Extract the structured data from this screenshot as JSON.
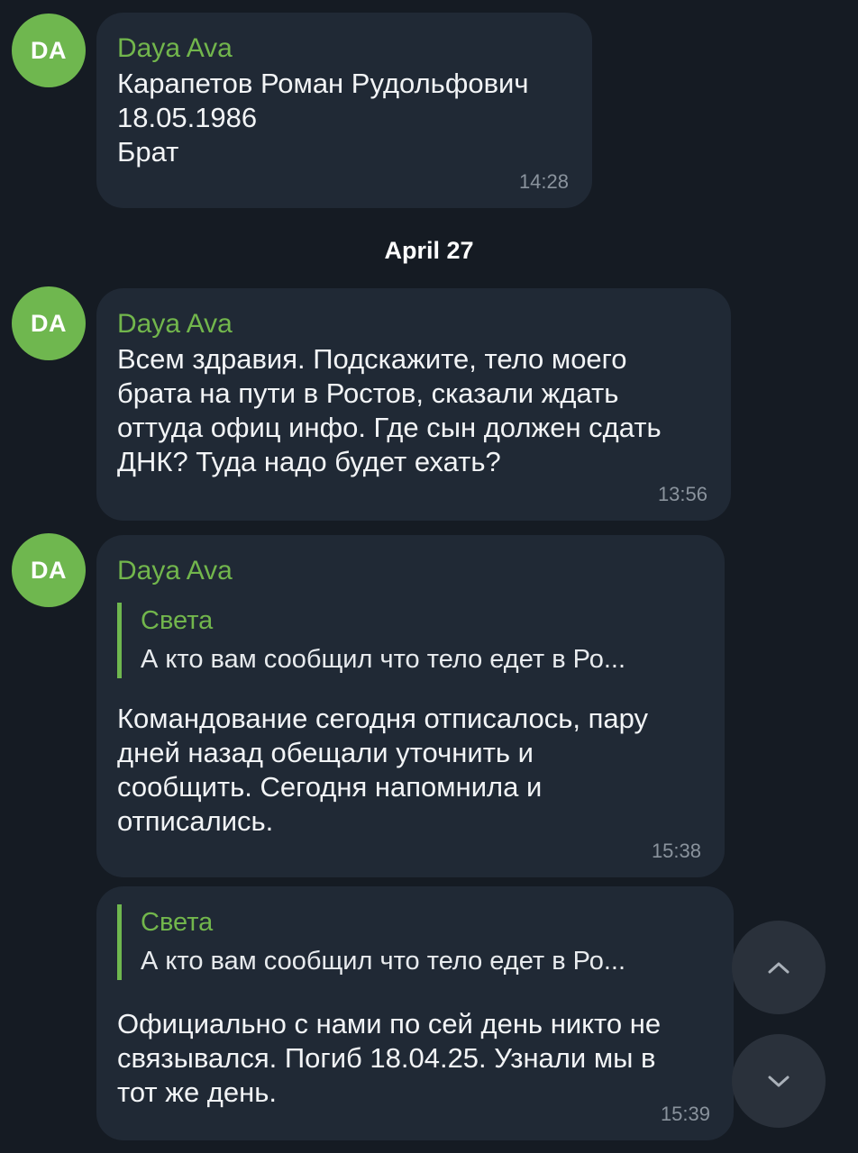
{
  "messages": [
    {
      "avatar": "DA",
      "sender": "Daya Ava",
      "text": "Карапетов Роман Рудольфович\n18.05.1986\nБрат",
      "time": "14:28"
    },
    {
      "avatar": "DA",
      "sender": "Daya Ava",
      "text": "Всем здравия. Подскажите, тело моего\nбрата на пути в Ростов, сказали ждать\nоттуда офиц инфо. Где сын должен сдать\nДНК? Туда надо будет ехать?",
      "time": "13:56"
    },
    {
      "avatar": "DA",
      "sender": "Daya Ava",
      "reply": {
        "name": "Света",
        "text": "А кто вам сообщил что тело едет в Ро..."
      },
      "text": "Командование сегодня отписалось, пару\nдней назад обещали уточнить и\nсообщить. Сегодня напомнила и\nотписались.",
      "time": "15:38"
    },
    {
      "reply": {
        "name": "Света",
        "text": "А кто вам сообщил что тело едет в Ро..."
      },
      "text": "Официально с нами по сей день никто не\nсвязывался. Погиб 18.04.25. Узнали мы в\nтот же день.",
      "time": "15:39"
    }
  ],
  "date_separator": "April 27",
  "icons": {
    "scroll_up": "chevron-up-icon",
    "scroll_down": "chevron-down-icon"
  },
  "colors": {
    "background": "#151b23",
    "bubble": "#202935",
    "accent": "#6fb74f",
    "time": "#8a939d"
  }
}
